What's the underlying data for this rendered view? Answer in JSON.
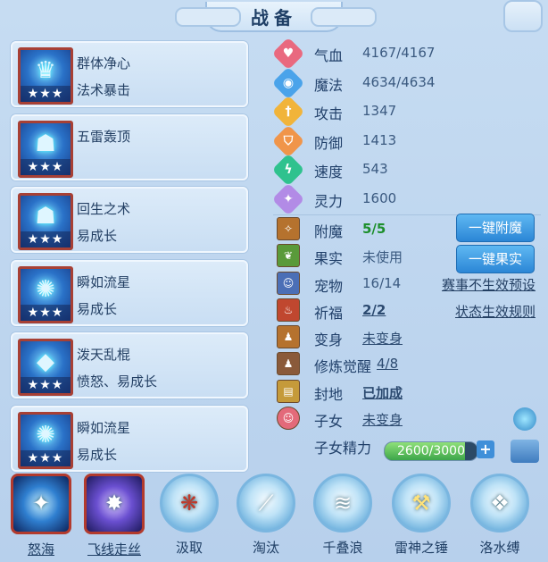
{
  "window": {
    "title": "战备"
  },
  "cards": [
    {
      "line1": "群体净心",
      "line2": "法术暴击",
      "stars": "★★★"
    },
    {
      "line1": "五雷轰顶",
      "line2": "",
      "stars": "★★★"
    },
    {
      "line1": "回生之术",
      "line2": "易成长",
      "stars": "★★★"
    },
    {
      "line1": "瞬如流星",
      "line2": "易成长",
      "stars": "★★★"
    },
    {
      "line1": "泼天乱棍",
      "line2": "愤怒、易成长",
      "stars": "★★★"
    },
    {
      "line1": "瞬如流星",
      "line2": "易成长",
      "stars": "★★★"
    }
  ],
  "stats": [
    {
      "label": "气血",
      "value": "4167/4167",
      "color": "#e9697f"
    },
    {
      "label": "魔法",
      "value": "4634/4634",
      "color": "#4aa3ea"
    },
    {
      "label": "攻击",
      "value": "1347",
      "color": "#f1b43a"
    },
    {
      "label": "防御",
      "value": "1413",
      "color": "#f0954a"
    },
    {
      "label": "速度",
      "value": "543",
      "color": "#2fc28e"
    },
    {
      "label": "灵力",
      "value": "1600",
      "color": "#b28be6"
    }
  ],
  "rows": {
    "enchant": {
      "label": "附魔",
      "value": "5/5"
    },
    "fruit": {
      "label": "果实",
      "value": "未使用"
    },
    "pet": {
      "label": "宠物",
      "value": "16/14",
      "link": "赛事不生效预设"
    },
    "bless": {
      "label": "祈福",
      "value": "2/2",
      "link": "状态生效规则"
    },
    "transform": {
      "label": "变身",
      "value": "未变身"
    },
    "cultivate": {
      "label": "修炼觉醒",
      "value": "4/8"
    },
    "land": {
      "label": "封地",
      "value": "已加成"
    },
    "child": {
      "label": "子女",
      "value": "未变身"
    },
    "child_energy": {
      "label": "子女精力",
      "value": "2600/3000",
      "fraction": 0.867
    }
  },
  "buttons": {
    "enchant": "一键附魔",
    "fruit": "一键果实"
  },
  "skills": [
    "怒海",
    "飞线走丝",
    "汲取",
    "淘汰",
    "千叠浪",
    "雷神之锤",
    "洛水缚"
  ]
}
